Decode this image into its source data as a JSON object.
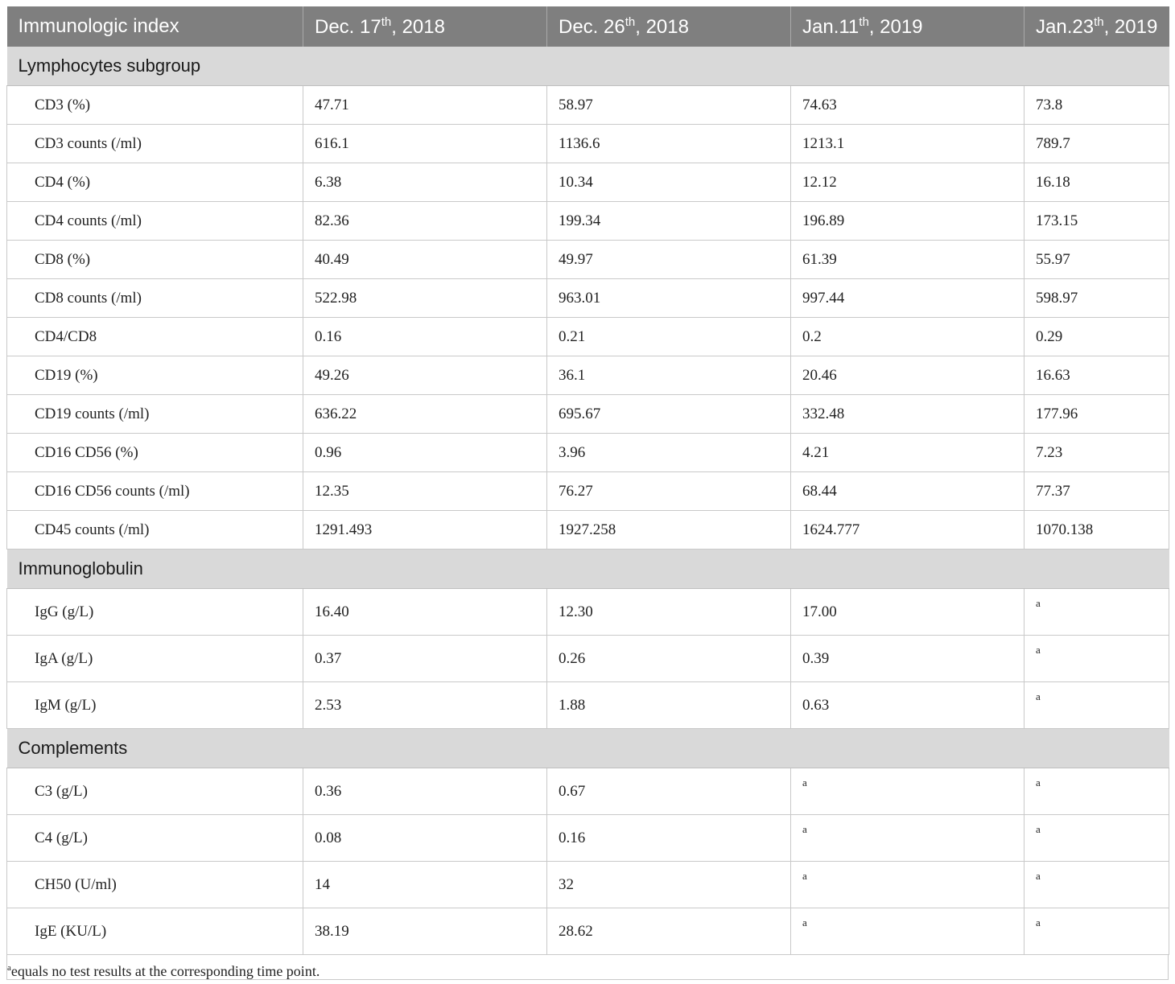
{
  "header": {
    "col0": "Immunologic index",
    "col1": {
      "pre": "Dec. 17",
      "sup": "th",
      "post": ", 2018"
    },
    "col2": {
      "pre": "Dec. 26",
      "sup": "th",
      "post": ", 2018"
    },
    "col3": {
      "pre": "Jan.11",
      "sup": "th",
      "post": ", 2019"
    },
    "col4": {
      "pre": "Jan.23",
      "sup": "th",
      "post": ", 2019"
    }
  },
  "sections": [
    {
      "title": "Lymphocytes subgroup",
      "rows": [
        [
          "CD3 (%)",
          "47.71",
          "58.97",
          "74.63",
          "73.8"
        ],
        [
          "CD3 counts (/ml)",
          "616.1",
          "1136.6",
          "1213.1",
          "789.7"
        ],
        [
          "CD4 (%)",
          "6.38",
          "10.34",
          "12.12",
          "16.18"
        ],
        [
          "CD4 counts (/ml)",
          "82.36",
          "199.34",
          "196.89",
          "173.15"
        ],
        [
          "CD8 (%)",
          "40.49",
          "49.97",
          "61.39",
          "55.97"
        ],
        [
          "CD8 counts (/ml)",
          "522.98",
          "963.01",
          "997.44",
          "598.97"
        ],
        [
          "CD4/CD8",
          "0.16",
          "0.21",
          "0.2",
          "0.29"
        ],
        [
          "CD19 (%)",
          "49.26",
          "36.1",
          "20.46",
          "16.63"
        ],
        [
          "CD19 counts (/ml)",
          "636.22",
          "695.67",
          "332.48",
          "177.96"
        ],
        [
          "CD16 CD56 (%)",
          "0.96",
          "3.96",
          "4.21",
          "7.23"
        ],
        [
          "CD16 CD56 counts (/ml)",
          "12.35",
          "76.27",
          "68.44",
          "77.37"
        ],
        [
          "CD45 counts (/ml)",
          "1291.493",
          "1927.258",
          "1624.777",
          "1070.138"
        ]
      ]
    },
    {
      "title": "Immunoglobulin",
      "rows": [
        [
          "IgG (g/L)",
          "16.40",
          "12.30",
          "17.00",
          "a"
        ],
        [
          "IgA (g/L)",
          "0.37",
          "0.26",
          "0.39",
          "a"
        ],
        [
          "IgM (g/L)",
          "2.53",
          "1.88",
          "0.63",
          "a"
        ]
      ]
    },
    {
      "title": "Complements",
      "rows": [
        [
          "C3 (g/L)",
          "0.36",
          "0.67",
          "a",
          "a"
        ],
        [
          "C4 (g/L)",
          "0.08",
          "0.16",
          "a",
          "a"
        ],
        [
          "CH50 (U/ml)",
          "14",
          "32",
          "a",
          "a"
        ],
        [
          "IgE (KU/L)",
          "38.19",
          "28.62",
          "a",
          "a"
        ]
      ]
    }
  ],
  "footnote": {
    "marker": "a",
    "text": "equals no test results at the corresponding time point."
  }
}
